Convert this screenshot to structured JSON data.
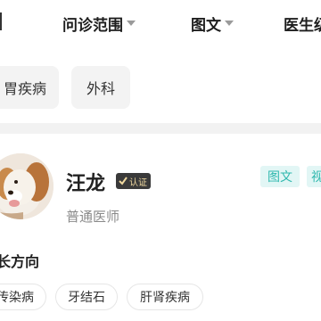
{
  "filter_bar": {
    "items": [
      {
        "label": "问诊范围"
      },
      {
        "label": "图文"
      },
      {
        "label": "医生级"
      }
    ]
  },
  "departments": [
    {
      "label": "胃疾病"
    },
    {
      "label": "外科"
    }
  ],
  "doctor": {
    "name": "汪龙",
    "badge": "认证",
    "title": "普通医师",
    "service_tags": [
      {
        "label": "图文"
      },
      {
        "label": "视"
      }
    ],
    "specialty_heading": "长方向",
    "specialties": [
      {
        "label": "传染病"
      },
      {
        "label": "牙结石"
      },
      {
        "label": "肝肾疾病"
      }
    ]
  },
  "colors": {
    "accent_teal": "#2fb8ae",
    "tag_bg": "#e2f6f5",
    "badge_bg": "#3a3a3a",
    "badge_text": "#f0d9a0"
  }
}
